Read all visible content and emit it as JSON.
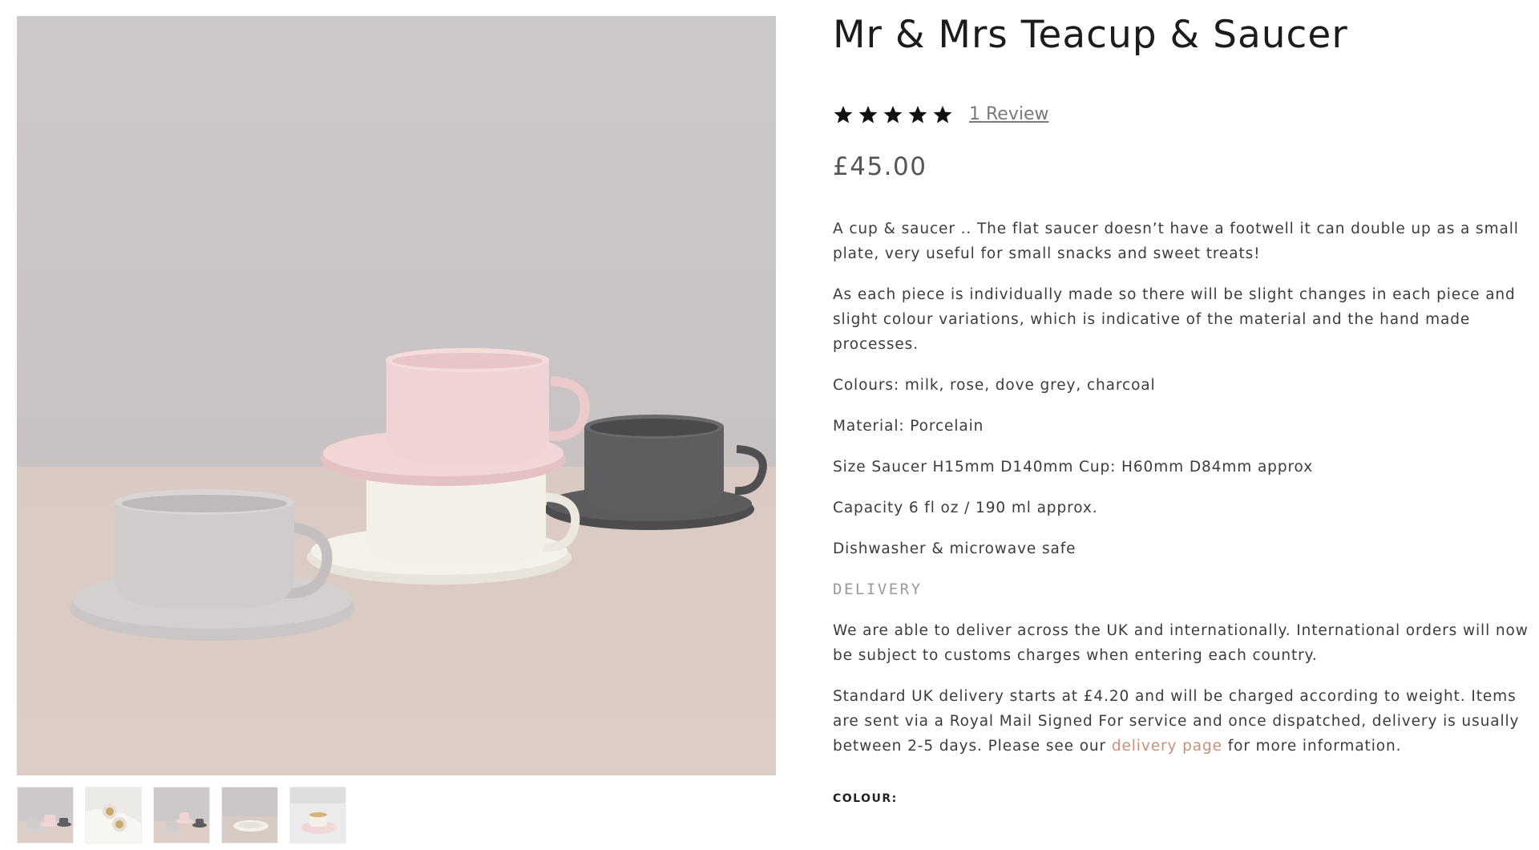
{
  "product": {
    "title": "Mr & Mrs Teacup & Saucer",
    "rating_stars": 5,
    "review_link": "1 Review",
    "price": "£45.00"
  },
  "description": {
    "paragraphs": [
      "A cup & saucer .. The flat saucer doesn’t have a footwell it can double up as a small plate, very useful for small snacks and sweet treats!",
      "As each piece is individually made so there will be slight changes in each piece and slight colour variations, which is indicative of the material and the hand made processes.",
      "Colours: milk, rose, dove grey, charcoal",
      "Material: Porcelain",
      "Size Saucer H15mm D140mm Cup: H60mm D84mm approx",
      "Capacity 6 fl oz / 190 ml approx.",
      "Dishwasher & microwave safe"
    ],
    "delivery_heading": "DELIVERY",
    "delivery_paragraph_1": "We are able to deliver across the UK and internationally. International orders will now be subject to customs charges when entering each country.",
    "delivery_paragraph_2_before": "Standard UK delivery starts at £4.20 and will be charged according to weight. Items are sent via a Royal Mail Signed For service and once dispatched, delivery is usually between 2-5 days. Please see our ",
    "delivery_link": "delivery page",
    "delivery_paragraph_2_after": " for more information."
  },
  "options": {
    "colour_label": "COLOUR:"
  },
  "colors": {
    "star": "#111111",
    "link_accent": "#c9907c",
    "cup_rose": "#efd0d2",
    "cup_milk": "#f3efe6",
    "cup_dove_grey": "#cfcccb",
    "cup_charcoal": "#5b5b5d",
    "backdrop": "#cbc6c8",
    "tablecloth": "#dcccc5"
  },
  "icons": {
    "rating": "star-icon"
  }
}
